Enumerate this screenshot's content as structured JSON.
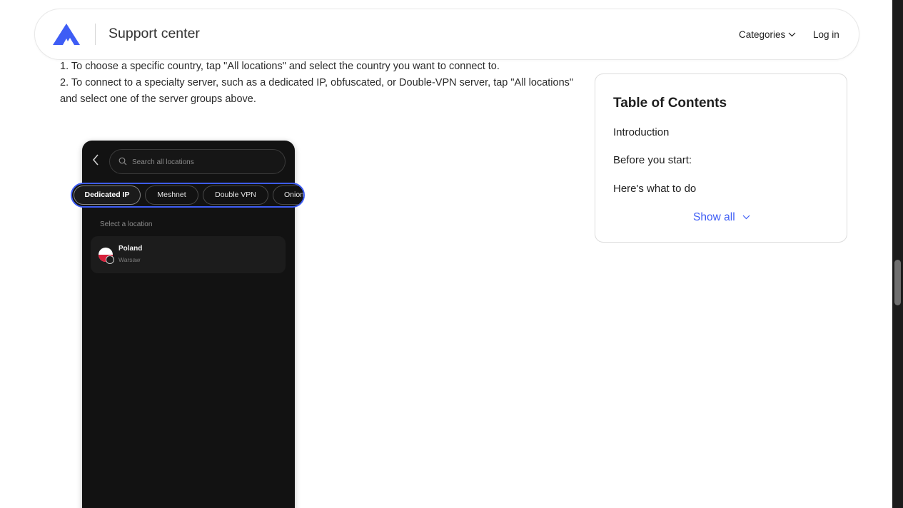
{
  "header": {
    "title": "Support center",
    "categories_label": "Categories",
    "login_label": "Log in",
    "brand_color": "#3e5df5"
  },
  "article": {
    "paragraphs": [
      "1. To choose a specific country, tap \"All locations\" and select the country you want to connect to.",
      "2. To connect to a specialty server, such as a dedicated IP, obfuscated, or Double-VPN server, tap \"All locations\" and select one of the server groups above."
    ]
  },
  "phone": {
    "search_placeholder": "Search all locations",
    "chips": [
      "Dedicated IP",
      "Meshnet",
      "Double VPN",
      "Onion"
    ],
    "active_chip": "Dedicated IP",
    "section_label": "Select a location",
    "location": {
      "country": "Poland",
      "city": "Warsaw"
    }
  },
  "toc": {
    "title": "Table of Contents",
    "items": [
      "Introduction",
      "Before you start:",
      "Here's what to do"
    ],
    "show_all_label": "Show all"
  }
}
